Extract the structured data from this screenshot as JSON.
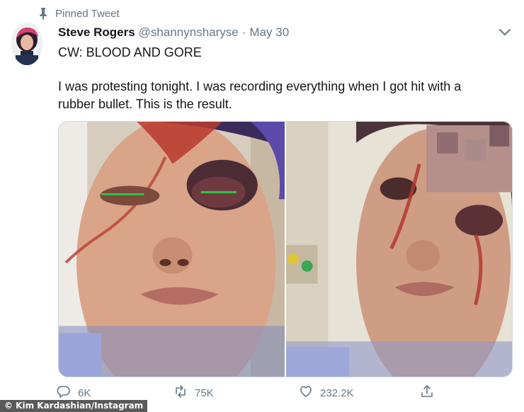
{
  "pinned": {
    "label": "Pinned Tweet",
    "icon": "pin-icon"
  },
  "tweet": {
    "author_name": "Steve Rogers",
    "author_handle": "@shannynsharyse",
    "separator": "·",
    "date": "May 30",
    "content_warning": "CW: BLOOD AND GORE",
    "text_line_1": "I was protesting tonight. I was recording everything when I got hit with a",
    "text_line_2": "rubber bullet. This is the result.",
    "media": [
      {
        "kind": "photo",
        "subject": "selfie-injured-eye-hospital"
      },
      {
        "kind": "photo",
        "subject": "selfie-injured-eye-hospital-blurred"
      }
    ]
  },
  "actions": {
    "reply_count": "6K",
    "retweet_count": "75K",
    "like_count": "232.2K",
    "share_icon": "share-icon"
  },
  "credit": "© Kim Kardashian/Instagram",
  "colors": {
    "text_primary": "#14171a",
    "text_secondary": "#657786",
    "border": "#ccd6dd"
  }
}
